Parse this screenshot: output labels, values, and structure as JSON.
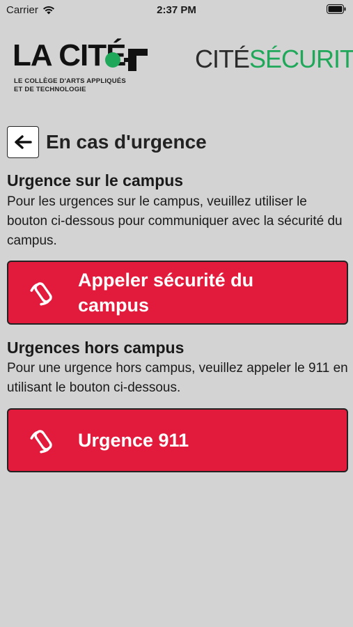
{
  "status_bar": {
    "carrier": "Carrier",
    "time": "2:37 PM"
  },
  "header": {
    "lacite_title": "LA CITÉ",
    "lacite_subtitle_line1": "LE COLLÈGE D'ARTS APPLIQUÉS",
    "lacite_subtitle_line2": "ET DE TECHNOLOGIE",
    "securite_part1": "CITÉ",
    "securite_part2": "SÉCURITÉ",
    "securite_green": "#1fa85a",
    "lacite_green": "#1fa85a"
  },
  "page": {
    "title": "En cas d'urgence"
  },
  "campus": {
    "heading": "Urgence sur le campus",
    "text": "Pour les urgences sur le campus, veuillez utiliser le bouton ci-dessous pour communiquer avec la sécurité du campus.",
    "button_line1": "Appeler sécurité du",
    "button_line2": "campus"
  },
  "offcampus": {
    "heading": "Urgences hors campus",
    "text": "Pour une urgence hors campus, veuillez appeler le 911 en utilisant le bouton ci-dessous.",
    "button_label": "Urgence 911"
  },
  "colors": {
    "button_red": "#e21b3c",
    "background": "#d3d3d3"
  },
  "icons": {
    "back": "arrow-left-icon",
    "phone": "phone-icon",
    "wifi": "wifi-icon",
    "battery": "battery-icon"
  }
}
